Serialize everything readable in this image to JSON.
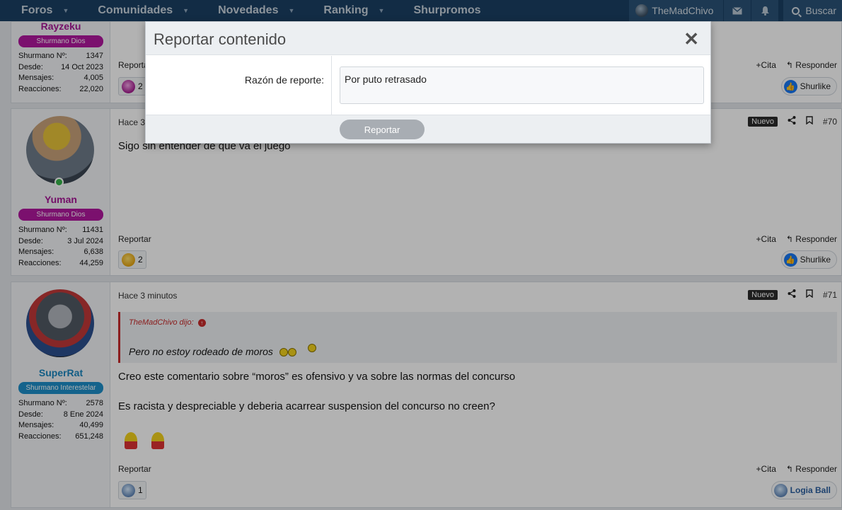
{
  "nav": {
    "items": [
      {
        "label": "Foros",
        "has_menu": true
      },
      {
        "label": "Comunidades",
        "has_menu": true
      },
      {
        "label": "Novedades",
        "has_menu": true
      },
      {
        "label": "Ranking",
        "has_menu": true
      },
      {
        "label": "Shurpromos",
        "has_menu": false
      }
    ],
    "user": "TheMadChivo",
    "search_label": "Buscar",
    "icons": [
      "user-avatar-icon",
      "envelope-icon",
      "bell-icon",
      "search-icon"
    ]
  },
  "posts": [
    {
      "username": "Rayzeku",
      "rank": "Shurmano Dios",
      "rank_color": "#b1179e",
      "name_color": "#a61595",
      "stats": [
        {
          "label": "Shurmano Nº:",
          "value": "1347"
        },
        {
          "label": "Desde:",
          "value": "14 Oct 2023"
        },
        {
          "label": "Mensajes:",
          "value": "4,005"
        },
        {
          "label": "Reacciones:",
          "value": "22,020"
        }
      ],
      "report_label": "Reportar",
      "quote_label": "Cita",
      "reply_label": "Responder",
      "reaction_count": "2",
      "like_label": "Shurlike"
    },
    {
      "username": "Yuman",
      "rank": "Shurmano Dios",
      "rank_color": "#b1179e",
      "name_color": "#a61595",
      "time": "Hace 3",
      "badge": "Nuevo",
      "post_number": "#70",
      "body": "Sigo sin entender de que va el juego",
      "stats": [
        {
          "label": "Shurmano Nº:",
          "value": "11431"
        },
        {
          "label": "Desde:",
          "value": "3 Jul 2024"
        },
        {
          "label": "Mensajes:",
          "value": "6,638"
        },
        {
          "label": "Reacciones:",
          "value": "44,259"
        }
      ],
      "report_label": "Reportar",
      "quote_label": "Cita",
      "reply_label": "Responder",
      "reaction_count": "2",
      "like_label": "Shurlike"
    },
    {
      "username": "SuperRat",
      "rank": "Shurmano Interestelar",
      "rank_color": "#1d8fc9",
      "name_color": "#1a86bf",
      "time": "Hace 3 minutos",
      "badge": "Nuevo",
      "post_number": "#71",
      "quote_author": "TheMadChivo dijo:",
      "quote_text": "Pero no estoy rodeado de moros",
      "body_lines": [
        "Creo este comentario sobre “moros” es ofensivo y va sobre las normas del concurso",
        "Es racista y despreciable y deberia acarrear suspension del concurso no creen?"
      ],
      "stats": [
        {
          "label": "Shurmano Nº:",
          "value": "2578"
        },
        {
          "label": "Desde:",
          "value": "8 Ene 2024"
        },
        {
          "label": "Mensajes:",
          "value": "40,499"
        },
        {
          "label": "Reacciones:",
          "value": "651,248"
        }
      ],
      "report_label": "Reportar",
      "quote_label": "Cita",
      "reply_label": "Responder",
      "reaction_count": "1",
      "like_label": "Logia Ball"
    }
  ],
  "modal": {
    "title": "Reportar contenido",
    "close_icon": "close-icon",
    "reason_label": "Razón de reporte:",
    "reason_value": "Por puto retrasado",
    "submit_label": "Reportar"
  }
}
